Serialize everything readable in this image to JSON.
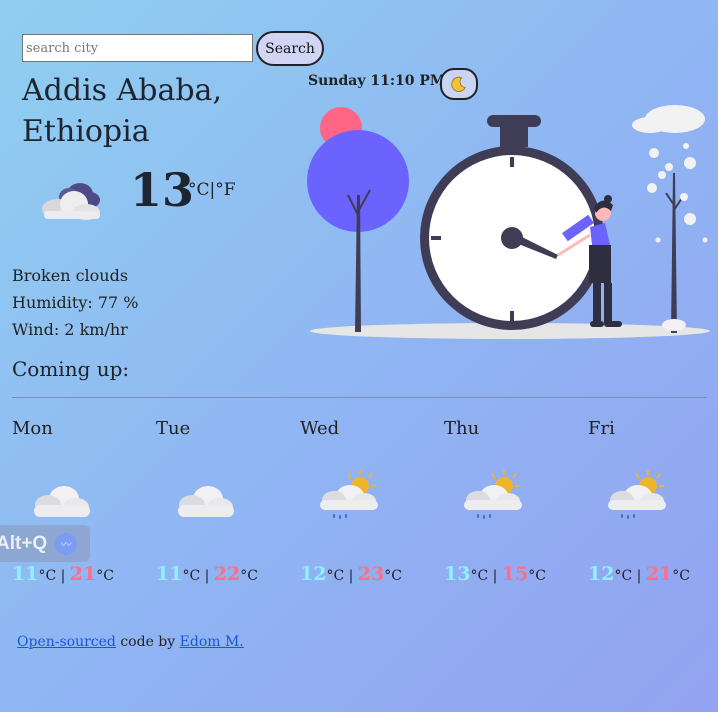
{
  "search": {
    "placeholder": "search city",
    "button_label": "Search"
  },
  "location": {
    "city": "Addis Ababa,",
    "country": "Ethiopia"
  },
  "datetime": "Sunday 11:10 PM",
  "theme_icon": "moon-icon",
  "current": {
    "temperature": "13",
    "unit_c": "°C",
    "separator": "|",
    "unit_f": "°F",
    "icon": "broken-clouds-icon",
    "description": "Broken clouds",
    "humidity": "Humidity: 77 %",
    "wind": "Wind: 2 km/hr"
  },
  "forecast_heading": "Coming up:",
  "forecast": [
    {
      "day": "Mon",
      "low": "11",
      "high": "21",
      "unit": "°C",
      "sep": "|",
      "icon": "cloud-icon"
    },
    {
      "day": "Tue",
      "low": "11",
      "high": "22",
      "unit": "°C",
      "sep": "|",
      "icon": "cloud-icon"
    },
    {
      "day": "Wed",
      "low": "12",
      "high": "23",
      "unit": "°C",
      "sep": "|",
      "icon": "sun-cloud-rain-icon"
    },
    {
      "day": "Thu",
      "low": "13",
      "high": "15",
      "unit": "°C",
      "sep": "|",
      "icon": "sun-cloud-rain-icon"
    },
    {
      "day": "Fri",
      "low": "12",
      "high": "21",
      "unit": "°C",
      "sep": "|",
      "icon": "sun-cloud-rain-icon"
    }
  ],
  "overlay": {
    "shortcut_label": "Alt+Q"
  },
  "footer": {
    "link1": "Open-sourced",
    "middle": " code by ",
    "link2": "Edom M."
  },
  "colors": {
    "low_temp": "#8ff0ff",
    "high_temp": "#ff6d86",
    "accent_purple": "#6c63ff"
  }
}
